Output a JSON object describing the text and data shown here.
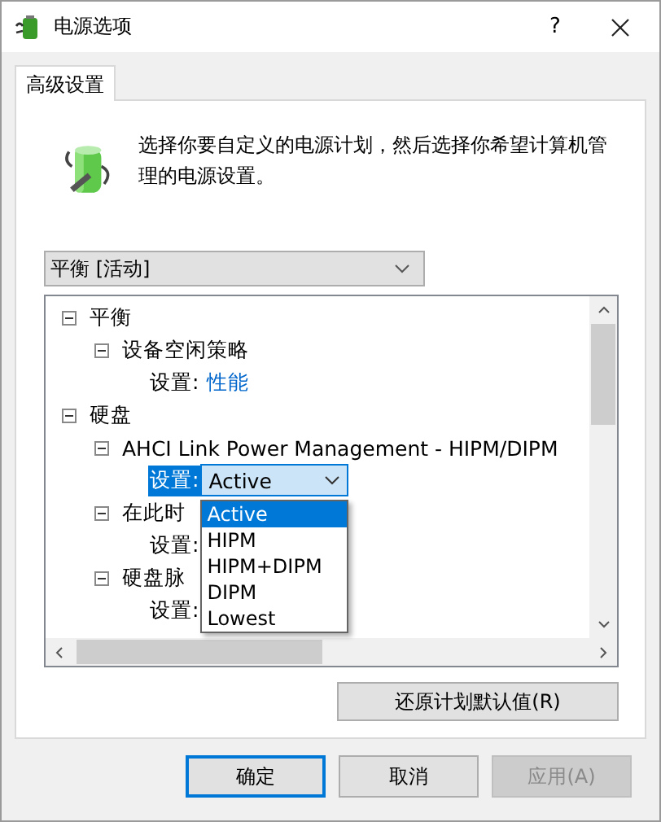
{
  "window": {
    "title": "电源选项",
    "help": "?"
  },
  "tabs": [
    {
      "label": "高级设置",
      "selected": true
    }
  ],
  "intro": "选择你要自定义的电源计划，然后选择你希望计算机管理的电源设置。",
  "plan_select": {
    "value": "平衡 [活动]"
  },
  "tree": [
    {
      "kind": "group",
      "label": "平衡",
      "expanded": true,
      "children": [
        {
          "kind": "group",
          "label": "设备空闲策略",
          "expanded": true,
          "children": [
            {
              "kind": "setting",
              "label": "设置:",
              "value": "性能"
            }
          ]
        }
      ]
    },
    {
      "kind": "group",
      "label": "硬盘",
      "expanded": true,
      "children": [
        {
          "kind": "group",
          "label": "AHCI Link Power Management - HIPM/DIPM",
          "expanded": true,
          "children": [
            {
              "kind": "combo",
              "label": "设置:",
              "selected": true,
              "value": "Active",
              "open": true,
              "options": [
                {
                  "label": "Active",
                  "selected": true
                },
                {
                  "label": "HIPM",
                  "selected": false
                },
                {
                  "label": "HIPM+DIPM",
                  "selected": false
                },
                {
                  "label": "DIPM",
                  "selected": false
                },
                {
                  "label": "Lowest",
                  "selected": false
                }
              ]
            }
          ]
        },
        {
          "kind": "group",
          "label": "在此时",
          "expanded": true,
          "children": [
            {
              "kind": "setting",
              "label": "设置:"
            }
          ]
        },
        {
          "kind": "group",
          "label": "硬盘脉",
          "expanded": true,
          "children": [
            {
              "kind": "setting",
              "label": "设置:"
            }
          ]
        }
      ]
    }
  ],
  "restore_button": "还原计划默认值(R)",
  "buttons": [
    {
      "label": "确定",
      "default": true,
      "disabled": false
    },
    {
      "label": "取消",
      "default": false,
      "disabled": false
    },
    {
      "label": "应用(A)",
      "default": false,
      "disabled": true
    }
  ]
}
